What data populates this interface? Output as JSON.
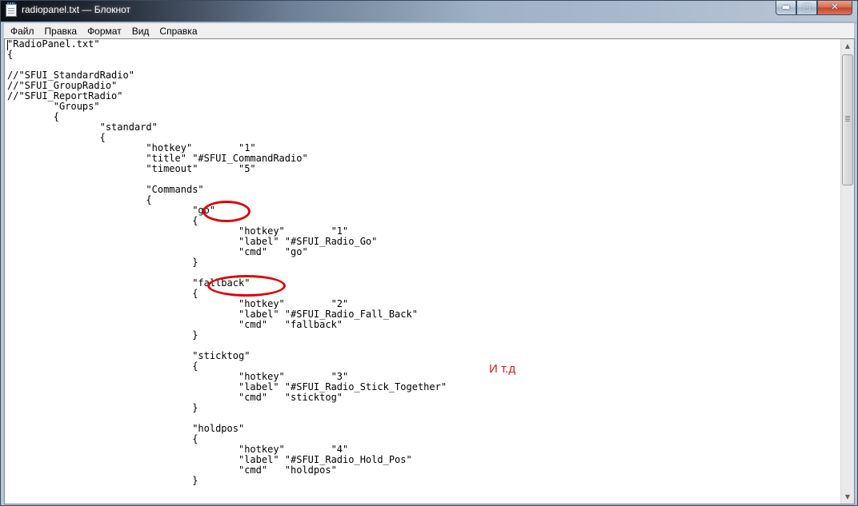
{
  "window": {
    "title": "radiopanel.txt — Блокнот",
    "buttons": {
      "minimize": "▬",
      "maximize": "□",
      "close": "✕"
    }
  },
  "menu": {
    "items": [
      "Файл",
      "Правка",
      "Формат",
      "Вид",
      "Справка"
    ]
  },
  "editor": {
    "content": "\"RadioPanel.txt\"\n{\n\n//\"SFUI_StandardRadio\"\n//\"SFUI_GroupRadio\"\n//\"SFUI_ReportRadio\"\n\t\"Groups\"\n\t{\n\t\t\"standard\"\n\t\t{\n\t\t\t\"hotkey\"\t\"1\"\n\t\t\t\"title\" \"#SFUI_CommandRadio\"\n\t\t\t\"timeout\"\t\"5\"\n\n\t\t\t\"Commands\"\n\t\t\t{\n\t\t\t\t\"go\"\n\t\t\t\t{\n\t\t\t\t\t\"hotkey\"\t\"1\"\n\t\t\t\t\t\"label\" \"#SFUI_Radio_Go\"\n\t\t\t\t\t\"cmd\"\t\"go\"\n\t\t\t\t}\n\n\t\t\t\t\"fallback\"\n\t\t\t\t{\n\t\t\t\t\t\"hotkey\"\t\"2\"\n\t\t\t\t\t\"label\" \"#SFUI_Radio_Fall_Back\"\n\t\t\t\t\t\"cmd\"\t\"fallback\"\n\t\t\t\t}\n\n\t\t\t\t\"sticktog\"\n\t\t\t\t{\n\t\t\t\t\t\"hotkey\"\t\"3\"\n\t\t\t\t\t\"label\" \"#SFUI_Radio_Stick_Together\"\n\t\t\t\t\t\"cmd\"\t\"sticktog\"\n\t\t\t\t}\n\n\t\t\t\t\"holdpos\"\n\t\t\t\t{\n\t\t\t\t\t\"hotkey\"\t\"4\"\n\t\t\t\t\t\"label\" \"#SFUI_Radio_Hold_Pos\"\n\t\t\t\t\t\"cmd\"\t\"holdpos\"\n\t\t\t\t}"
  },
  "annotation": {
    "text": "И т.д",
    "color": "#e01a1a"
  },
  "highlight_color": "#e00000",
  "icons": {
    "app": "notepad-icon",
    "scroll_up": "▲",
    "scroll_down": "▼"
  }
}
